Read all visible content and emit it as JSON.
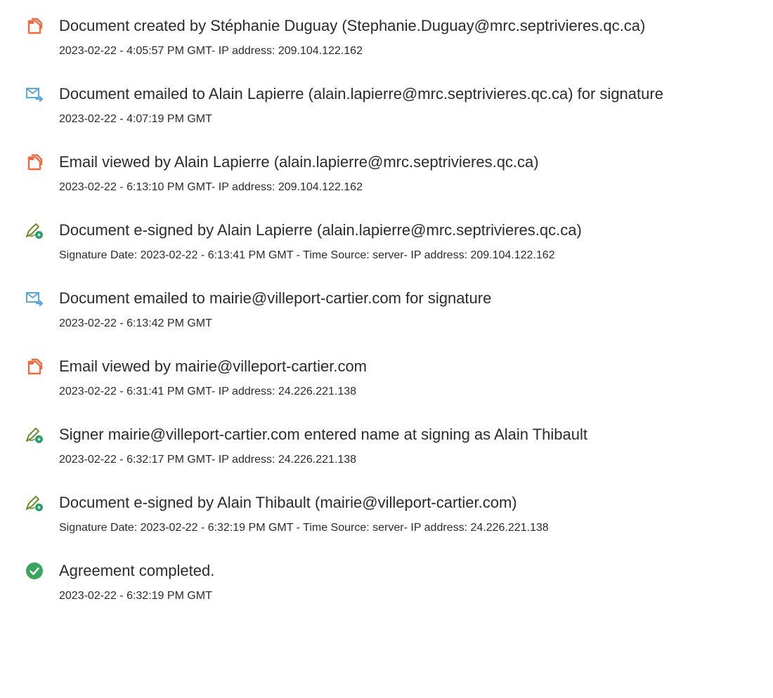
{
  "events": [
    {
      "icon": "document-created-icon",
      "title": "Document created by Stéphanie Duguay (Stephanie.Duguay@mrc.septrivieres.qc.ca)",
      "detail": "2023-02-22 - 4:05:57 PM GMT- IP address: 209.104.122.162"
    },
    {
      "icon": "email-sent-icon",
      "title": "Document emailed to Alain Lapierre (alain.lapierre@mrc.septrivieres.qc.ca) for signature",
      "detail": "2023-02-22 - 4:07:19 PM GMT"
    },
    {
      "icon": "document-viewed-icon",
      "title": "Email viewed by Alain Lapierre (alain.lapierre@mrc.septrivieres.qc.ca)",
      "detail": "2023-02-22 - 6:13:10 PM GMT- IP address: 209.104.122.162"
    },
    {
      "icon": "pen-sign-icon",
      "title": "Document e-signed by Alain Lapierre (alain.lapierre@mrc.septrivieres.qc.ca)",
      "detail": "Signature Date: 2023-02-22 - 6:13:41 PM GMT - Time Source: server- IP address: 209.104.122.162"
    },
    {
      "icon": "email-sent-icon",
      "title": "Document emailed to mairie@villeport-cartier.com for signature",
      "detail": "2023-02-22 - 6:13:42 PM GMT"
    },
    {
      "icon": "document-viewed-icon",
      "title": "Email viewed by mairie@villeport-cartier.com",
      "detail": "2023-02-22 - 6:31:41 PM GMT- IP address: 24.226.221.138"
    },
    {
      "icon": "pen-sign-icon",
      "title": "Signer mairie@villeport-cartier.com entered name at signing as Alain Thibault",
      "detail": "2023-02-22 - 6:32:17 PM GMT- IP address: 24.226.221.138"
    },
    {
      "icon": "pen-sign-icon",
      "title": "Document e-signed by Alain Thibault (mairie@villeport-cartier.com)",
      "detail": "Signature Date: 2023-02-22 - 6:32:19 PM GMT - Time Source: server- IP address: 24.226.221.138"
    },
    {
      "icon": "check-circle-icon",
      "title": "Agreement completed.",
      "detail": "2023-02-22 - 6:32:19 PM GMT"
    }
  ],
  "colors": {
    "document_icon": "#f26a3d",
    "email_icon": "#5aa9dc",
    "pen_icon": "#6b8f2e",
    "pen_badge": "#2a9d6f",
    "check_icon": "#3aa55d",
    "text": "#2b2b2b"
  }
}
